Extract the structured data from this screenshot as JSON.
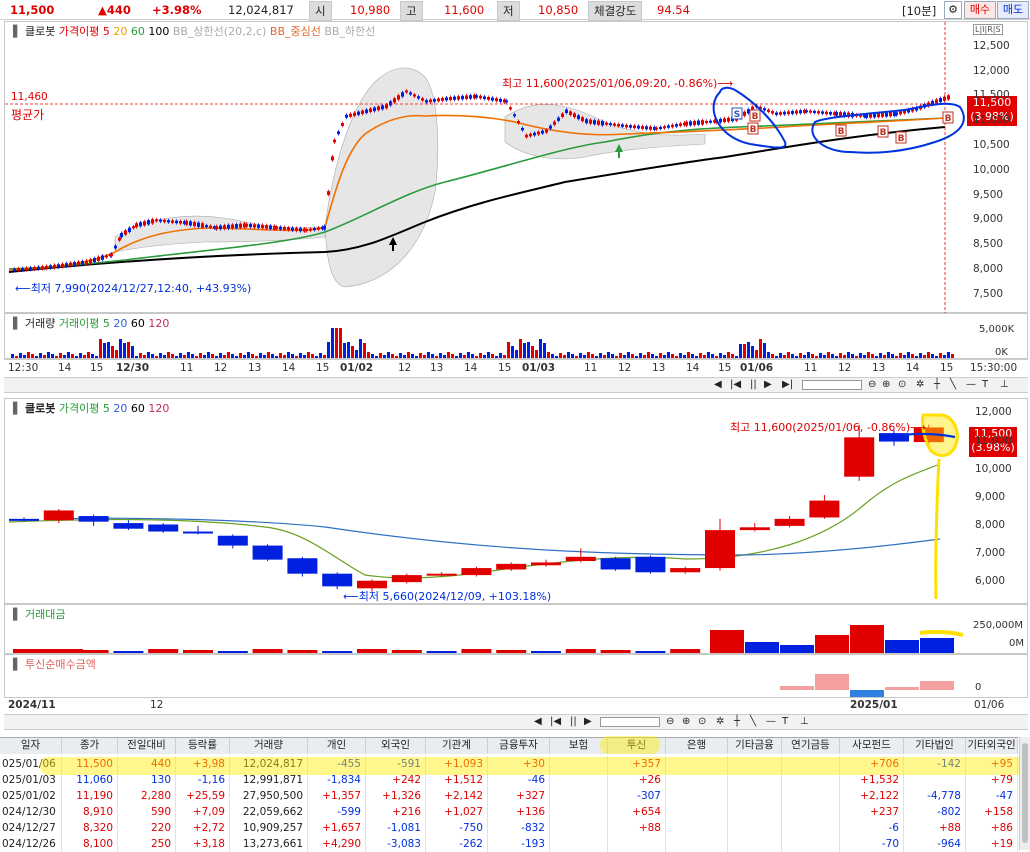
{
  "header": {
    "price": "11,500",
    "change": "▲440",
    "change_pct": "+3.98%",
    "volume": "12,024,817",
    "open_label": "시",
    "open": "10,980",
    "high_label": "고",
    "high": "11,600",
    "low_label": "저",
    "low": "10,850",
    "strength_label": "체결강도",
    "strength": "94.54",
    "period": "[10분]",
    "buy_label": "매수",
    "sell_label": "매도"
  },
  "intraday": {
    "title": "클로봇",
    "ma_label": "가격이평 5",
    "ma20": "20",
    "ma60": "60",
    "ma100": "100",
    "bb_upper": "BB_상한선(20,2,c)",
    "bb_mid": "BB_중심선",
    "bb_lower": "BB_하한선",
    "max_note": "최고 11,600(2025/01/06,09:20, -0.86%)⟶",
    "min_note": "⟵최저 7,990(2024/12/27,12:40, +43.93%)",
    "avg_price_value": "11,460",
    "avg_price_label": "평균가",
    "last_price": "11,500",
    "last_pct": "(3.98%)",
    "y_ticks": [
      "12,500",
      "12,000",
      "11,500",
      "11,000",
      "10,500",
      "10,000",
      "9,500",
      "9,000",
      "8,500",
      "8,000",
      "7,500"
    ],
    "scale_tag": "L|I|R|S"
  },
  "intraday_volume": {
    "title": "거래량",
    "ma_label": "거래이평 5",
    "m20": "20",
    "m60": "60",
    "m120": "120",
    "y_ticks": [
      "5,000K",
      "0K"
    ],
    "x_ticks": [
      "12:30",
      "14",
      "15",
      "12/30",
      "11",
      "12",
      "13",
      "14",
      "15",
      "01/02",
      "12",
      "13",
      "14",
      "15",
      "01/03",
      "11",
      "12",
      "13",
      "14",
      "15",
      "01/06",
      "11",
      "12",
      "13",
      "14",
      "15",
      "15:30:00"
    ]
  },
  "daily": {
    "title": "클로봇",
    "ma_label": "가격이평 5",
    "m20": "20",
    "m60": "60",
    "m120": "120",
    "max_note": "최고 11,600(2025/01/06, -0.86%)⟶",
    "min_note": "⟵최저 5,660(2024/12/09, +103.18%)",
    "last_price": "11,500",
    "last_pct": "(3.98%)",
    "y_ticks": [
      "12,000",
      "11,000",
      "10,000",
      "9,000",
      "8,000",
      "7,000",
      "6,000"
    ]
  },
  "trade_value": {
    "title": "거래대금",
    "y_ticks": [
      "250,000M",
      "0M"
    ]
  },
  "trust": {
    "title": "투신순매수금액",
    "y_ticks": [
      "0"
    ],
    "x_ticks": [
      "2024/11",
      "12",
      "2025/01",
      "01/06"
    ]
  },
  "table": {
    "headers": [
      "일자",
      "종가",
      "전일대비",
      "등락률",
      "거래량",
      "개인",
      "외국인",
      "기관계",
      "금융투자",
      "보험",
      "투신",
      "은행",
      "기타금융",
      "연기금등",
      "사모펀드",
      "기타법인",
      "기타외국인"
    ],
    "rows": [
      [
        "025/01/06",
        "11,500",
        "440",
        "+3,98",
        "12,024,817",
        "-455",
        "-591",
        "+1,093",
        "+30",
        "",
        "+357",
        "",
        "",
        "",
        "+706",
        "-142",
        "+95"
      ],
      [
        "025/01/03",
        "11,060",
        "130",
        "-1,16",
        "12,991,871",
        "-1,834",
        "+242",
        "+1,512",
        "-46",
        "",
        "+26",
        "",
        "",
        "",
        "+1,532",
        "",
        "+79"
      ],
      [
        "025/01/02",
        "11,190",
        "2,280",
        "+25,59",
        "27,950,500",
        "+1,357",
        "+1,326",
        "+2,142",
        "+327",
        "",
        "-307",
        "",
        "",
        "",
        "+2,122",
        "-4,778",
        "-47"
      ],
      [
        "024/12/30",
        "8,910",
        "590",
        "+7,09",
        "22,059,662",
        "-599",
        "+216",
        "+1,027",
        "+136",
        "",
        "+654",
        "",
        "",
        "",
        "+237",
        "-802",
        "+158"
      ],
      [
        "024/12/27",
        "8,320",
        "220",
        "+2,72",
        "10,909,257",
        "+1,657",
        "-1,081",
        "-750",
        "-832",
        "",
        "+88",
        "",
        "",
        "",
        "-6",
        "+88",
        "+86"
      ],
      [
        "024/12/26",
        "8,100",
        "250",
        "+3,18",
        "13,273,661",
        "+4,290",
        "-3,083",
        "-262",
        "-193",
        "",
        "",
        "",
        "",
        "",
        "-70",
        "-964",
        "+19"
      ]
    ]
  },
  "chart_data": [
    {
      "type": "candlestick",
      "title": "클로봇",
      "interval": "10분",
      "y_ticks": [
        7500,
        8000,
        8500,
        9000,
        9500,
        10000,
        10500,
        11000,
        11500,
        12000,
        12500
      ],
      "ylim": [
        7250,
        12800
      ],
      "max": {
        "value": 11600,
        "date": "2025/01/06,09:20",
        "pct": -0.86
      },
      "min": {
        "value": 7990,
        "date": "2024/12/27,12:40",
        "pct": 43.93
      },
      "avg_price": 11460,
      "last": 11500,
      "sessions": [
        "12/27",
        "12/30",
        "01/02",
        "01/03",
        "01/06"
      ],
      "series": [
        {
          "name": "가격이평 5"
        },
        {
          "name": "20"
        },
        {
          "name": "60"
        },
        {
          "name": "100"
        },
        {
          "name": "BB_상한선(20,2,c)"
        },
        {
          "name": "BB_중심선"
        },
        {
          "name": "BB_하한선"
        }
      ]
    },
    {
      "type": "candlestick",
      "title": "클로봇",
      "interval": "일",
      "y_ticks": [
        6000,
        7000,
        8000,
        9000,
        10000,
        11000,
        12000
      ],
      "ylim": [
        5400,
        12300
      ],
      "max": {
        "value": 11600,
        "date": "2025/01/06",
        "pct": -0.86
      },
      "min": {
        "value": 5660,
        "date": "2024/12/09",
        "pct": 103.18
      },
      "candles": [
        {
          "o": 8250,
          "c": 8200,
          "h": 8300,
          "l": 8150
        },
        {
          "o": 8200,
          "c": 8550,
          "h": 8600,
          "l": 8100
        },
        {
          "o": 8350,
          "c": 8150,
          "h": 8400,
          "l": 8000
        },
        {
          "o": 8100,
          "c": 7900,
          "h": 8200,
          "l": 7850
        },
        {
          "o": 8050,
          "c": 7800,
          "h": 8100,
          "l": 7750
        },
        {
          "o": 7800,
          "c": 7750,
          "h": 8000,
          "l": 7700
        },
        {
          "o": 7650,
          "c": 7300,
          "h": 7700,
          "l": 7200
        },
        {
          "o": 7300,
          "c": 6800,
          "h": 7350,
          "l": 6750
        },
        {
          "o": 6850,
          "c": 6300,
          "h": 6900,
          "l": 6200
        },
        {
          "o": 6300,
          "c": 5850,
          "h": 6350,
          "l": 5750
        },
        {
          "o": 5780,
          "c": 6050,
          "h": 6100,
          "l": 5660
        },
        {
          "o": 6000,
          "c": 6250,
          "h": 6300,
          "l": 5950
        },
        {
          "o": 6250,
          "c": 6300,
          "h": 6350,
          "l": 6200
        },
        {
          "o": 6250,
          "c": 6500,
          "h": 6550,
          "l": 6200
        },
        {
          "o": 6450,
          "c": 6650,
          "h": 6700,
          "l": 6400
        },
        {
          "o": 6600,
          "c": 6700,
          "h": 6800,
          "l": 6550
        },
        {
          "o": 6750,
          "c": 6900,
          "h": 7200,
          "l": 6700
        },
        {
          "o": 6850,
          "c": 6450,
          "h": 6900,
          "l": 6400
        },
        {
          "o": 6900,
          "c": 6350,
          "h": 6950,
          "l": 6300
        },
        {
          "o": 6350,
          "c": 6500,
          "h": 6550,
          "l": 6300
        },
        {
          "o": 6500,
          "c": 7850,
          "h": 8250,
          "l": 6400
        },
        {
          "o": 7850,
          "c": 7950,
          "h": 8100,
          "l": 7800
        },
        {
          "o": 8000,
          "c": 8250,
          "h": 8350,
          "l": 7950
        },
        {
          "o": 8300,
          "c": 8900,
          "h": 9100,
          "l": 8250
        },
        {
          "o": 9750,
          "c": 11150,
          "h": 11600,
          "l": 9600
        },
        {
          "o": 11300,
          "c": 11000,
          "h": 11400,
          "l": 10850
        },
        {
          "o": 10980,
          "c": 11500,
          "h": 11600,
          "l": 10850
        }
      ],
      "series": [
        {
          "name": "가격이평 5"
        },
        {
          "name": "20"
        },
        {
          "name": "60"
        },
        {
          "name": "120"
        }
      ]
    },
    {
      "type": "bar",
      "title": "거래대금",
      "y_ticks": [
        "250,000M",
        "0M"
      ]
    },
    {
      "type": "bar",
      "title": "투신순매수금액",
      "y_ticks": [
        "0"
      ]
    }
  ]
}
